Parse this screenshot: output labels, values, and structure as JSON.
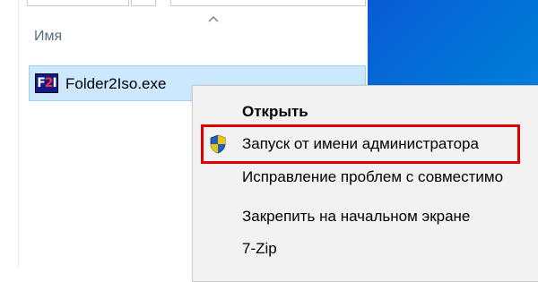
{
  "explorer": {
    "column_header": "Имя",
    "file": {
      "name": "Folder2Iso.exe",
      "icon_text_1": "F",
      "icon_text_2": "2",
      "icon_text_3": "I"
    }
  },
  "context_menu": {
    "items": [
      {
        "label": "Открыть",
        "icon": ""
      },
      {
        "label": "Запуск от имени администратора",
        "icon": "uac-shield-icon"
      },
      {
        "label": "Исправление проблем с совместимо",
        "icon": ""
      },
      {
        "label": "Закрепить на начальном экране",
        "icon": ""
      },
      {
        "label": "7-Zip",
        "icon": ""
      }
    ]
  },
  "colors": {
    "highlight": "#e00000",
    "selection": "#cce8ff",
    "desktop": "#0078d7"
  }
}
